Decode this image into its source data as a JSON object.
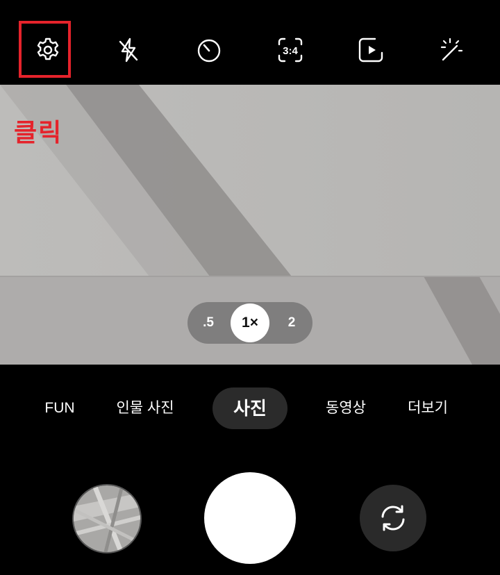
{
  "top_bar": {
    "icons": [
      "gear-icon",
      "flash-off-icon",
      "timer-icon",
      "aspect-ratio-icon",
      "motion-photo-icon",
      "filter-effects-icon"
    ],
    "aspect_ratio_label": "3:4"
  },
  "annotation": {
    "label": "클릭",
    "color": "#e5232b"
  },
  "viewfinder": {
    "zoom_options": [
      ".5",
      "1×",
      "2"
    ],
    "selected_zoom": "1×"
  },
  "modes": {
    "items": [
      "FUN",
      "인물 사진",
      "사진",
      "동영상",
      "더보기"
    ],
    "selected": "사진"
  },
  "controls": {
    "gallery_icon": "gallery-thumbnail",
    "shutter_icon": "shutter-button",
    "switch_icon": "switch-camera-icon"
  }
}
